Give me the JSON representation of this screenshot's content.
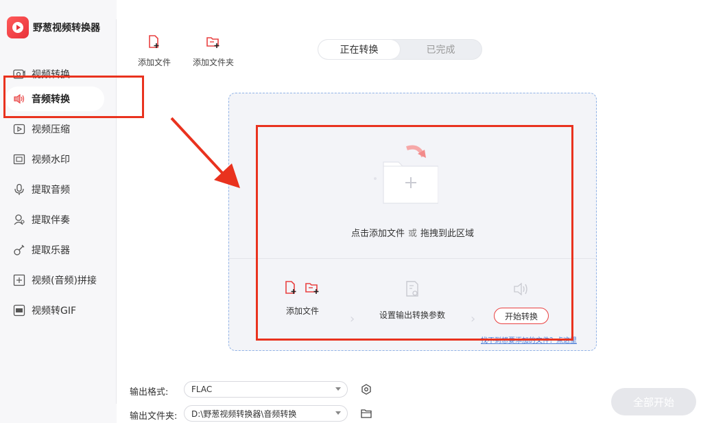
{
  "app": {
    "title": "野葱视频转换器"
  },
  "sidebar": {
    "items": [
      {
        "label": "视频转换",
        "icon": "video-convert-icon"
      },
      {
        "label": "音频转换",
        "icon": "audio-convert-icon",
        "active": true
      },
      {
        "label": "视频压缩",
        "icon": "video-compress-icon"
      },
      {
        "label": "视频水印",
        "icon": "watermark-icon"
      },
      {
        "label": "提取音频",
        "icon": "extract-audio-icon"
      },
      {
        "label": "提取伴奏",
        "icon": "extract-accompaniment-icon"
      },
      {
        "label": "提取乐器",
        "icon": "guitar-icon"
      },
      {
        "label": "视频(音频)拼接",
        "icon": "merge-icon"
      },
      {
        "label": "视频转GIF",
        "icon": "gif-icon"
      }
    ]
  },
  "toolbar": {
    "add_file_label": "添加文件",
    "add_folder_label": "添加文件夹"
  },
  "tabs": {
    "converting": "正在转换",
    "completed": "已完成"
  },
  "dropzone": {
    "prompt_main": "点击添加文件",
    "prompt_or": "或",
    "prompt_drag": "拖拽到此区域",
    "step1_label": "添加文件",
    "step2_label": "设置输出转换参数",
    "step3_label": "开始转换",
    "help_link": "找不到想要添加的文件？点这里"
  },
  "output": {
    "format_label": "输出格式:",
    "format_value": "FLAC",
    "folder_label": "输出文件夹:",
    "folder_value": "D:\\野葱视频转换器\\音频转换"
  },
  "start_all_label": "全部开始",
  "colors": {
    "accent": "#e94040",
    "highlight": "#e9321e",
    "dropzone_border": "#8fb1e6"
  }
}
